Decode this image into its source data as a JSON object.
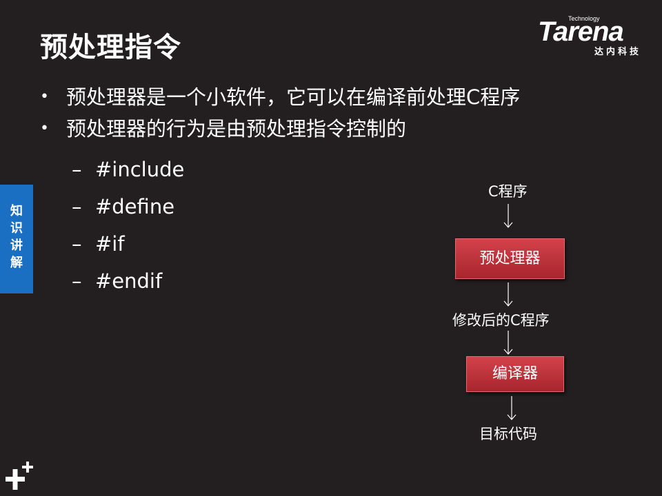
{
  "slide": {
    "title": "预处理指令",
    "logo": {
      "technology": "Technology",
      "brand": "Tarena",
      "subtitle": "达内科技"
    },
    "side_tab": "知识讲解",
    "bullets": [
      "预处理器是一个小软件，它可以在编译前处理C程序",
      "预处理器的行为是由预处理指令控制的"
    ],
    "sub_items": [
      "#include",
      "#define",
      "#if",
      "#endif"
    ],
    "flow": {
      "start": "C程序",
      "step1": "预处理器",
      "middle": "修改后的C程序",
      "step2": "编译器",
      "end": "目标代码"
    }
  },
  "colors": {
    "background": "#231f20",
    "side_tab": "#1b6fc2",
    "box_red": "#c1333c"
  }
}
